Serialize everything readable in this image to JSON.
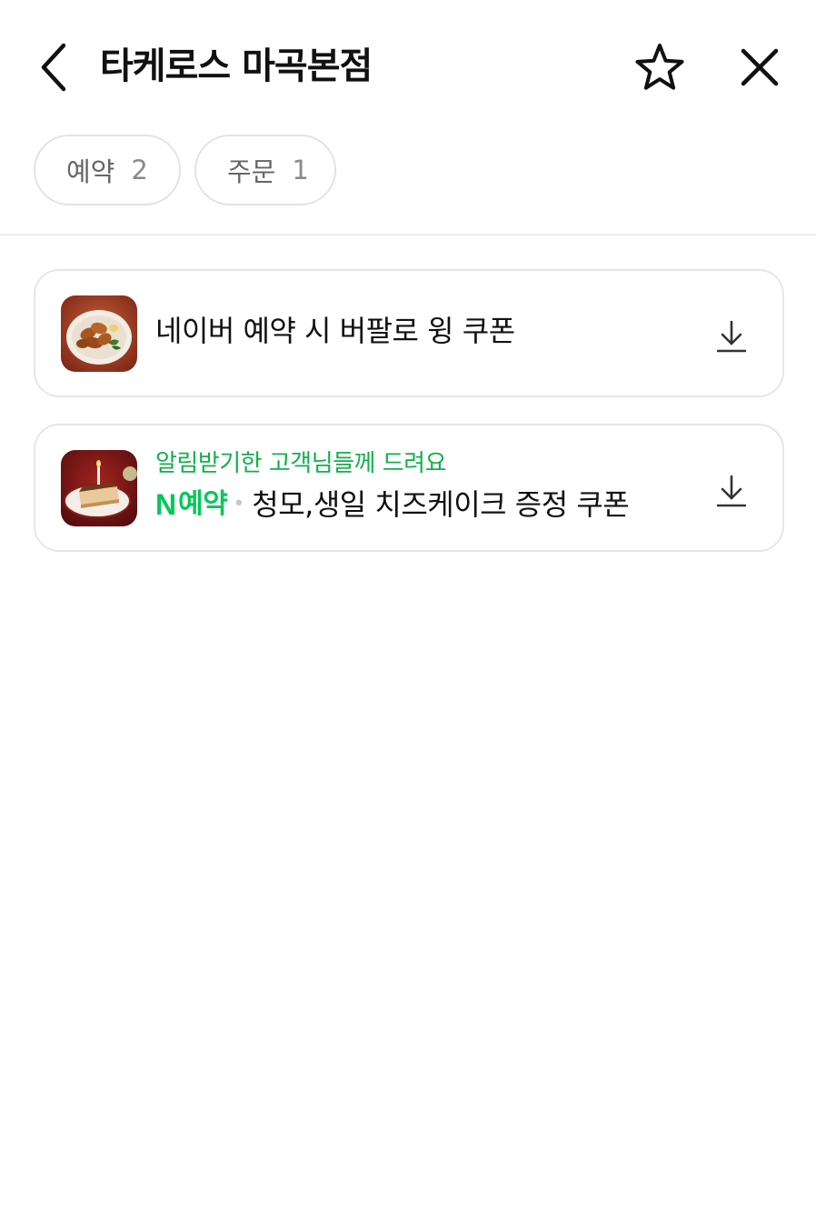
{
  "header": {
    "title": "타케로스 마곡본점",
    "back_icon": "chevron-left-icon",
    "star_icon": "star-outline-icon",
    "close_icon": "close-icon"
  },
  "tabs": [
    {
      "label": "예약",
      "count": "2"
    },
    {
      "label": "주문",
      "count": "1"
    }
  ],
  "coupons": [
    {
      "title": "네이버 예약 시 버팔로 윙 쿠폰",
      "image": "buffalo-wings-photo",
      "download_icon": "download-icon"
    },
    {
      "subtitle": "알림받기한 고객님들께 드려요",
      "badge_n": "N",
      "badge_label": "예약",
      "separator": "•",
      "title": "청모,생일 치즈케이크 증정 쿠폰",
      "image": "cheesecake-photo",
      "download_icon": "download-icon"
    }
  ],
  "colors": {
    "accent_green": "#03c75a",
    "subtitle_green": "#12b04b",
    "border": "#e6e6e6"
  }
}
